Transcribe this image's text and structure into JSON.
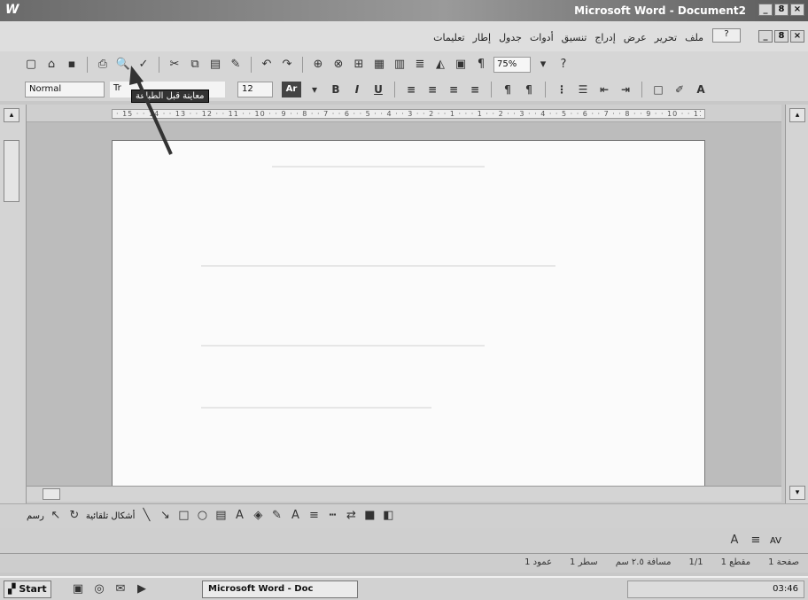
{
  "window": {
    "title": "Microsoft Word - Document2",
    "app_letter": "W",
    "minimize": "_",
    "maximize": "8",
    "close": "×"
  },
  "menu": {
    "items": [
      "ملف",
      "تحرير",
      "عرض",
      "إدراج",
      "تنسيق",
      "أدوات",
      "جدول",
      "إطار",
      "تعليمات"
    ],
    "help_box": "?"
  },
  "toolbar": {
    "zoom": "75%"
  },
  "format_bar": {
    "style": "Normal",
    "font": "Tr",
    "size": "12",
    "arabic_btn": "Ar",
    "bold": "B",
    "italic": "I",
    "underline": "U"
  },
  "tooltip": {
    "text": "معاينة قبل الطباعة"
  },
  "draw_bar": {
    "label": "رسم",
    "autoshapes": "أشكال تلقائية"
  },
  "bar3": {
    "label": "AV"
  },
  "status": {
    "page": "صفحة 1",
    "section": "مقطع 1",
    "count": "1/1",
    "at": "مسافة ٢.٥ سم",
    "line": "سطر 1",
    "col": "عمود 1"
  },
  "taskbar": {
    "start": "Start",
    "task": "Microsoft Word - Doc",
    "clock": "03:46"
  }
}
